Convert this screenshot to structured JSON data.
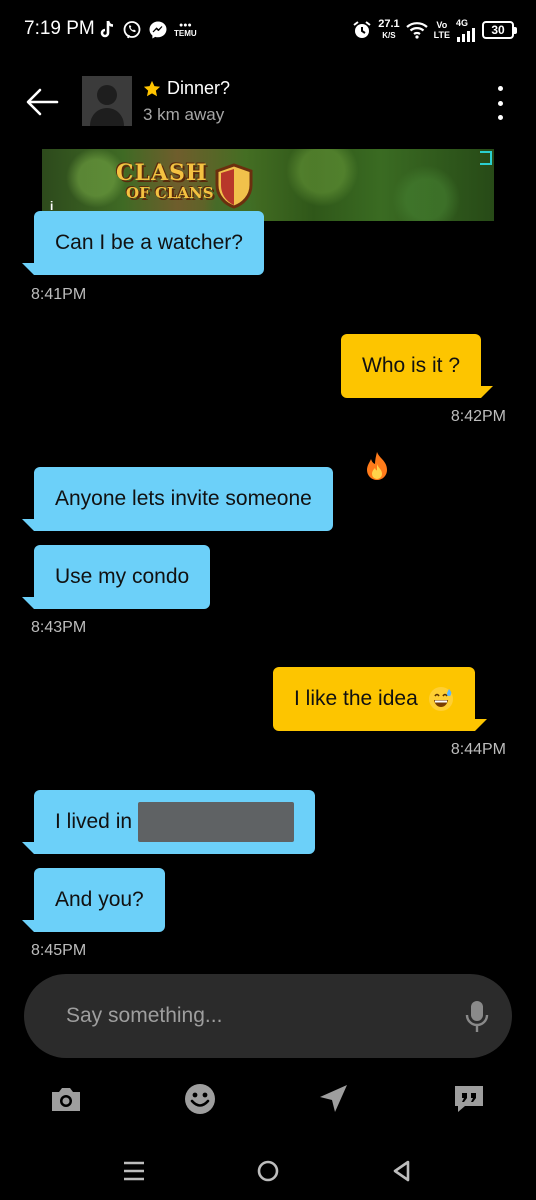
{
  "status": {
    "time": "7:19 PM",
    "left_icons": [
      "tiktok-icon",
      "viber-icon",
      "messenger-icon",
      "temu-icon"
    ],
    "temu_text": "TEMU",
    "net_speed": "27.1",
    "net_unit": "K/S",
    "volte_top": "Vo",
    "volte_bottom": "LTE",
    "network": "4G",
    "battery": "30"
  },
  "header": {
    "title": "Dinner?",
    "subtitle": "3 km away",
    "star_color": "#ffc400"
  },
  "ad": {
    "logo_line1": "CLASH",
    "logo_line2": "OF CLANS",
    "info": "i"
  },
  "messages": [
    {
      "id": "m1",
      "direction": "in",
      "text": "Can I be a watcher?"
    },
    {
      "id": "t1",
      "type": "time",
      "text": "8:41PM"
    },
    {
      "id": "m2",
      "direction": "out",
      "text": "Who is it ?"
    },
    {
      "id": "t2",
      "type": "time",
      "text": "8:42PM"
    },
    {
      "id": "m3",
      "direction": "in",
      "text": "Anyone lets invite someone",
      "reaction": "fire-emoji"
    },
    {
      "id": "m4",
      "direction": "in",
      "text": "Use my condo"
    },
    {
      "id": "t3",
      "type": "time",
      "text": "8:43PM"
    },
    {
      "id": "m5",
      "direction": "out",
      "text": "I like the idea",
      "emoji": "grinning-sweat-emoji"
    },
    {
      "id": "t4",
      "type": "time",
      "text": "8:44PM"
    },
    {
      "id": "m6",
      "direction": "in",
      "text": "I lived in",
      "redacted": true
    },
    {
      "id": "m7",
      "direction": "in",
      "text": "And you?"
    },
    {
      "id": "t5",
      "type": "time",
      "text": "8:45PM"
    }
  ],
  "colors": {
    "incoming_bubble": "#6cd0f9",
    "outgoing_bubble": "#fdc500",
    "background": "#000000"
  },
  "composer": {
    "placeholder": "Say something..."
  },
  "toolbar": [
    "camera-icon",
    "emoji-icon",
    "location-icon",
    "saved-phrases-icon"
  ],
  "navbar": [
    "menu-icon",
    "home-icon",
    "back-icon"
  ]
}
